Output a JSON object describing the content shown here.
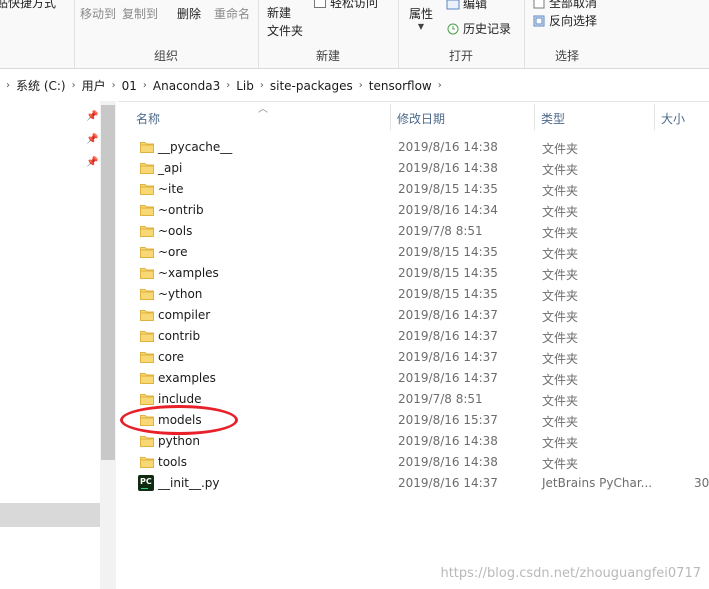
{
  "ribbon": {
    "clipboard_partial": "粘贴快捷方式",
    "move_to": "移动到",
    "copy_to": "复制到",
    "delete": "删除",
    "rename": "重命名",
    "organize_title": "组织",
    "new_folder_line1": "新建",
    "new_folder_line2": "文件夹",
    "easy_access": "轻松访问",
    "new_title": "新建",
    "properties": "属性",
    "edit": "编辑",
    "history": "历史记录",
    "open_title": "打开",
    "select_all": "全部取消",
    "invert_selection": "反向选择",
    "select_title": "选择"
  },
  "breadcrumb": [
    "系统 (C:)",
    "用户",
    "01",
    "Anaconda3",
    "Lib",
    "site-packages",
    "tensorflow"
  ],
  "columns": {
    "name": "名称",
    "date": "修改日期",
    "type": "类型",
    "size": "大小"
  },
  "files": [
    {
      "name": "__pycache__",
      "date": "2019/8/16 14:38",
      "type": "文件夹",
      "size": "",
      "kind": "folder"
    },
    {
      "name": "_api",
      "date": "2019/8/16 14:38",
      "type": "文件夹",
      "size": "",
      "kind": "folder"
    },
    {
      "name": "~ite",
      "date": "2019/8/15 14:35",
      "type": "文件夹",
      "size": "",
      "kind": "folder"
    },
    {
      "name": "~ontrib",
      "date": "2019/8/16 14:34",
      "type": "文件夹",
      "size": "",
      "kind": "folder"
    },
    {
      "name": "~ools",
      "date": "2019/7/8 8:51",
      "type": "文件夹",
      "size": "",
      "kind": "folder"
    },
    {
      "name": "~ore",
      "date": "2019/8/15 14:35",
      "type": "文件夹",
      "size": "",
      "kind": "folder"
    },
    {
      "name": "~xamples",
      "date": "2019/8/15 14:35",
      "type": "文件夹",
      "size": "",
      "kind": "folder"
    },
    {
      "name": "~ython",
      "date": "2019/8/15 14:35",
      "type": "文件夹",
      "size": "",
      "kind": "folder"
    },
    {
      "name": "compiler",
      "date": "2019/8/16 14:37",
      "type": "文件夹",
      "size": "",
      "kind": "folder"
    },
    {
      "name": "contrib",
      "date": "2019/8/16 14:37",
      "type": "文件夹",
      "size": "",
      "kind": "folder"
    },
    {
      "name": "core",
      "date": "2019/8/16 14:37",
      "type": "文件夹",
      "size": "",
      "kind": "folder"
    },
    {
      "name": "examples",
      "date": "2019/8/16 14:37",
      "type": "文件夹",
      "size": "",
      "kind": "folder"
    },
    {
      "name": "include",
      "date": "2019/7/8 8:51",
      "type": "文件夹",
      "size": "",
      "kind": "folder"
    },
    {
      "name": "models",
      "date": "2019/8/16 15:37",
      "type": "文件夹",
      "size": "",
      "kind": "folder"
    },
    {
      "name": "python",
      "date": "2019/8/16 14:38",
      "type": "文件夹",
      "size": "",
      "kind": "folder"
    },
    {
      "name": "tools",
      "date": "2019/8/16 14:38",
      "type": "文件夹",
      "size": "",
      "kind": "folder"
    },
    {
      "name": "__init__.py",
      "date": "2019/8/16 14:37",
      "type": "JetBrains PyChar...",
      "size": "30",
      "kind": "pycharm"
    }
  ],
  "watermark": "https://blog.csdn.net/zhouguangfei0717",
  "colors": {
    "folder": "#f8d775",
    "folder_dark": "#e0b33f",
    "highlight_ellipse": "#e8202a",
    "header_text": "#4d6a8a"
  }
}
